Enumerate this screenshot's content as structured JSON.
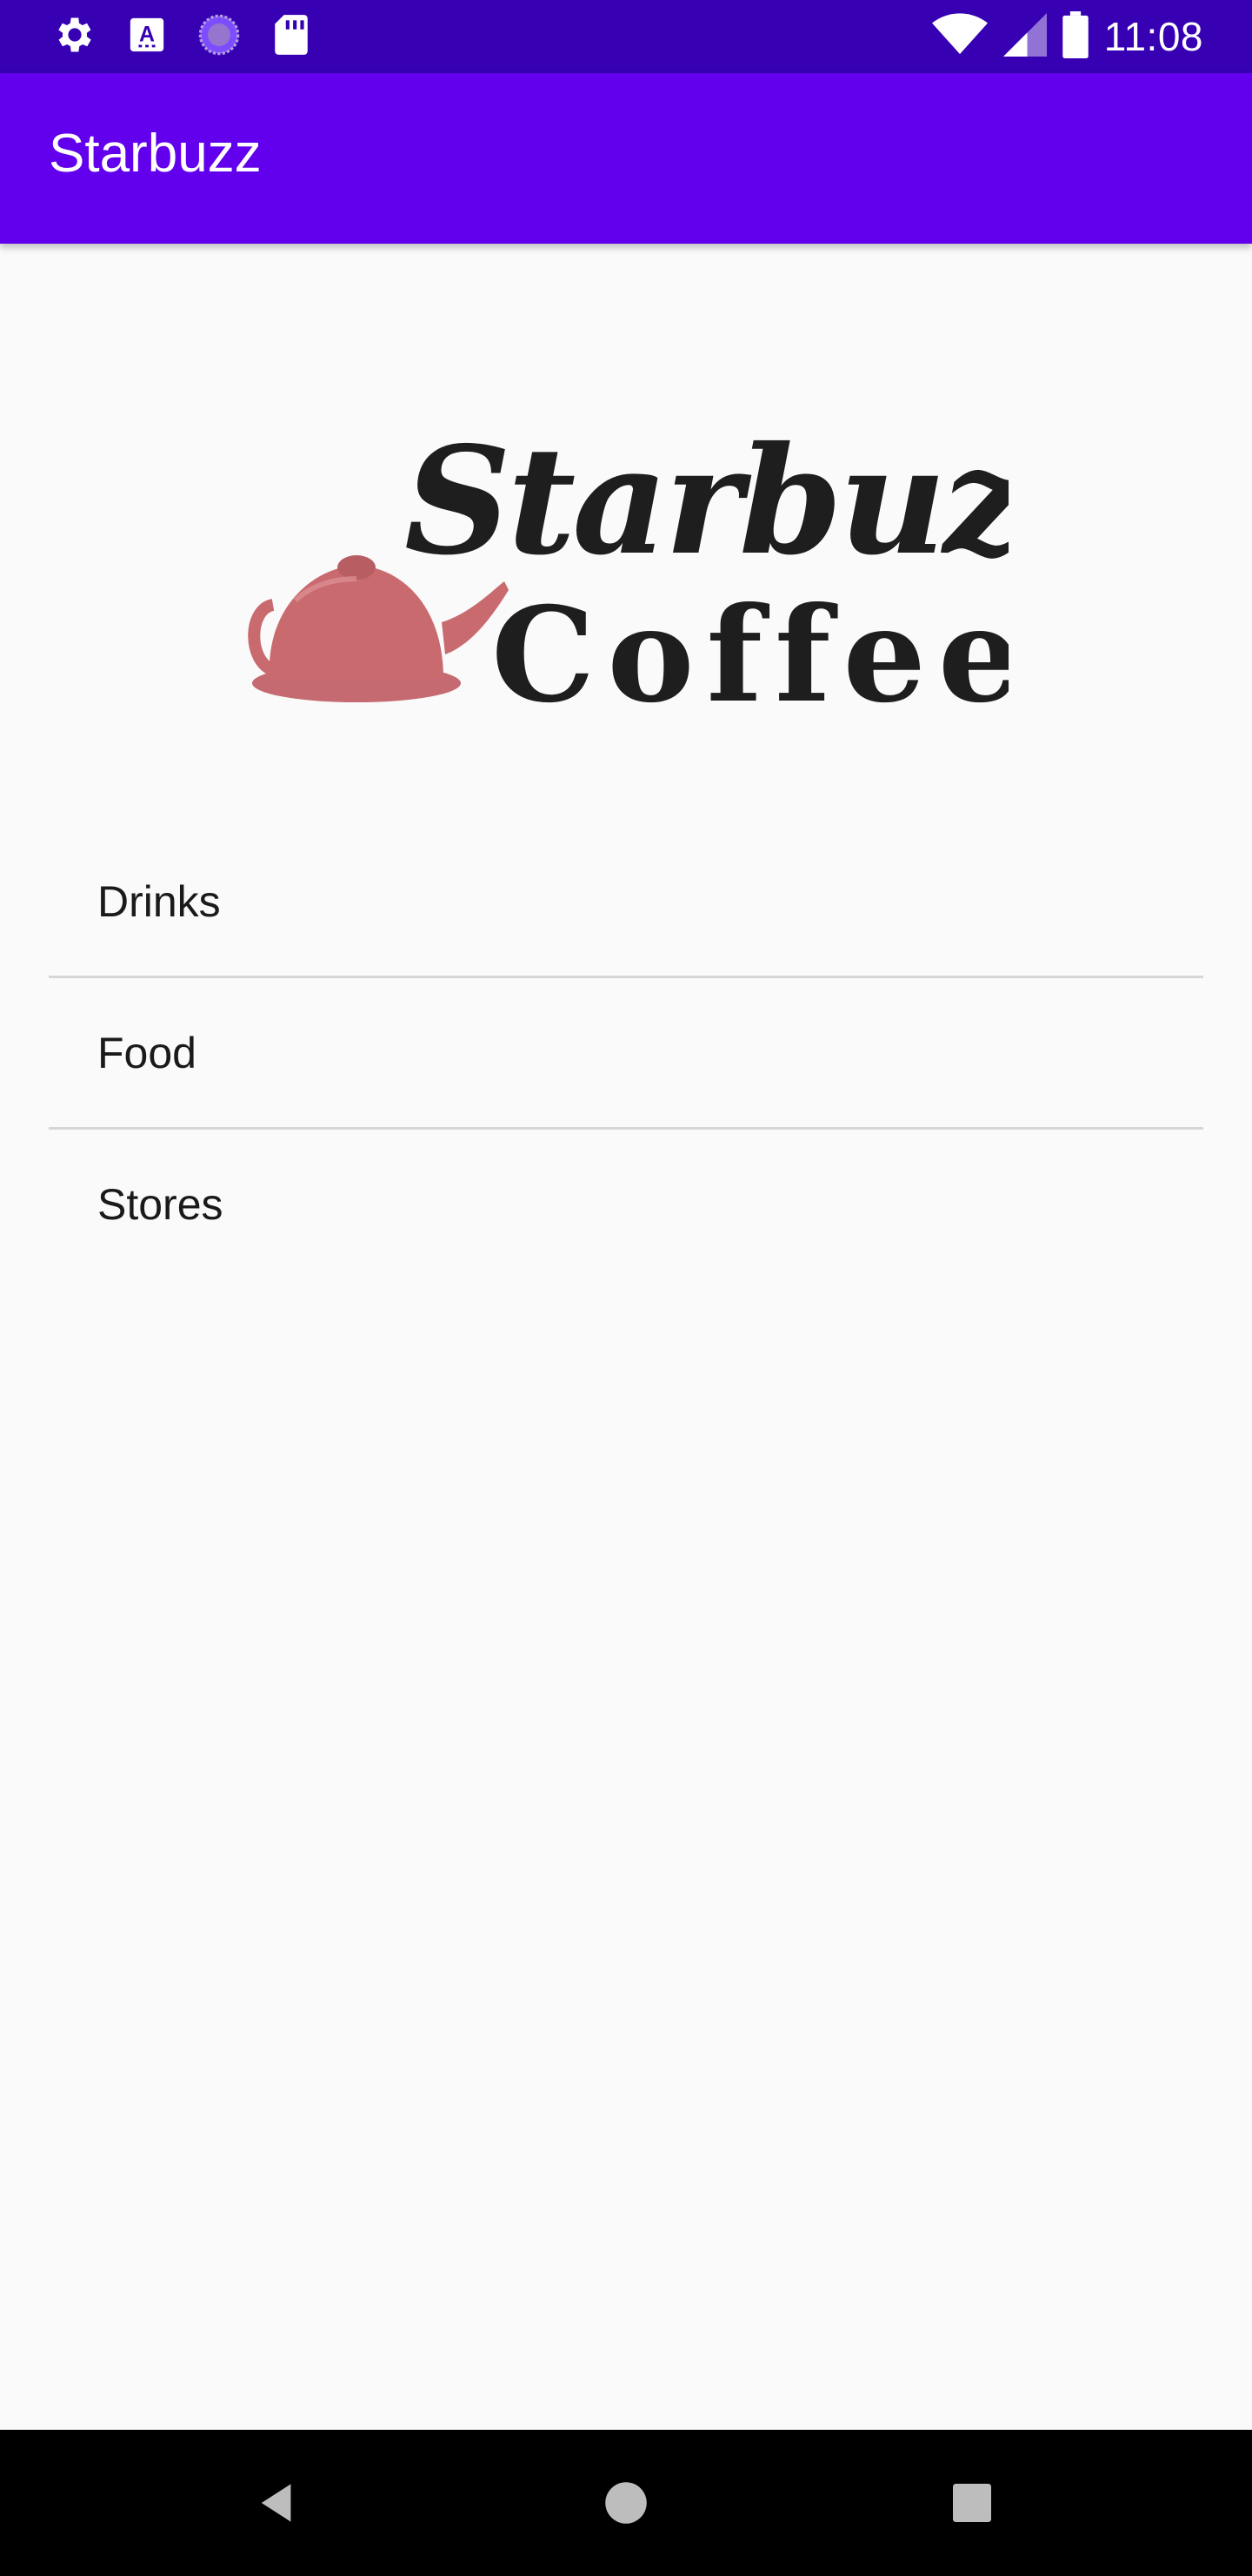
{
  "status_bar": {
    "time": "11:08",
    "icons_left": [
      "settings-icon",
      "a-badge-icon",
      "sync-icon",
      "sd-card-icon"
    ],
    "icons_right": [
      "wifi-icon",
      "signal-icon",
      "battery-icon"
    ],
    "background": "#3700b3"
  },
  "app_bar": {
    "title": "Starbuzz",
    "background": "#6200ee"
  },
  "logo": {
    "line1": "Starbuzz",
    "line2": "Coffee",
    "teapot_color": "#c96a6f"
  },
  "menu": {
    "items": [
      {
        "label": "Drinks"
      },
      {
        "label": "Food"
      },
      {
        "label": "Stores"
      }
    ]
  },
  "nav_bar": {
    "buttons": [
      "back-icon",
      "home-icon",
      "recents-icon"
    ]
  }
}
